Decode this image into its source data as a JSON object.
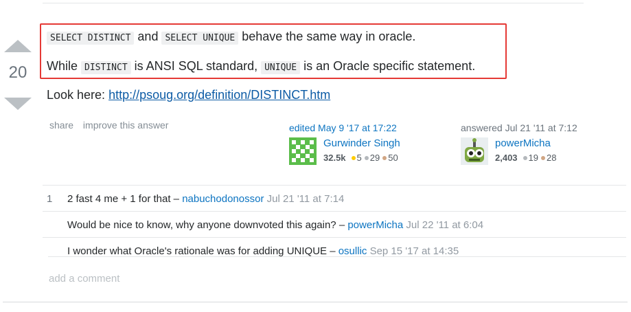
{
  "vote": {
    "count": "20"
  },
  "answer": {
    "line1": {
      "code1": "SELECT DISTINCT",
      "and": "and",
      "code2": "SELECT UNIQUE",
      "rest": "behave the same way in oracle."
    },
    "line2": {
      "pre": "While",
      "code1": "DISTINCT",
      "mid": "is ANSI SQL standard,",
      "code2": "UNIQUE",
      "rest": "is an Oracle specific statement."
    },
    "line3": {
      "pre": "Look here:",
      "link": "http://psoug.org/definition/DISTINCT.htm"
    }
  },
  "post_menu": {
    "share": "share",
    "improve": "improve this answer"
  },
  "editor": {
    "action": "edited May 9 '17 at 17:22",
    "name": "Gurwinder Singh",
    "rep": "32.5k",
    "gold": "5",
    "silver": "29",
    "bronze": "50",
    "avatar_icon": "identicon-green"
  },
  "author": {
    "action": "answered Jul 21 '11 at 7:12",
    "name": "powerMicha",
    "rep": "2,403",
    "silver": "19",
    "bronze": "28",
    "avatar_icon": "robot-avatar"
  },
  "comments": [
    {
      "score": "1",
      "text": "2 fast 4 me + 1 for that –",
      "user": "nabuchodonossor",
      "date": "Jul 21 '11 at 7:14"
    },
    {
      "score": "",
      "text": "Would be nice to know, why anyone downvoted this again? –",
      "user": "powerMicha",
      "date": "Jul 22 '11 at 6:04"
    },
    {
      "score": "",
      "text": "I wonder what Oracle's rationale was for adding UNIQUE –",
      "user": "osullic",
      "date": "Sep 15 '17 at 14:35"
    }
  ],
  "add_comment": "add a comment",
  "colors": {
    "highlight_border": "#e53935",
    "link": "#0c5ba5",
    "user_link": "#0c74c1",
    "gold": "#ffcc01",
    "silver": "#b4b8bc",
    "bronze": "#d1a684"
  }
}
